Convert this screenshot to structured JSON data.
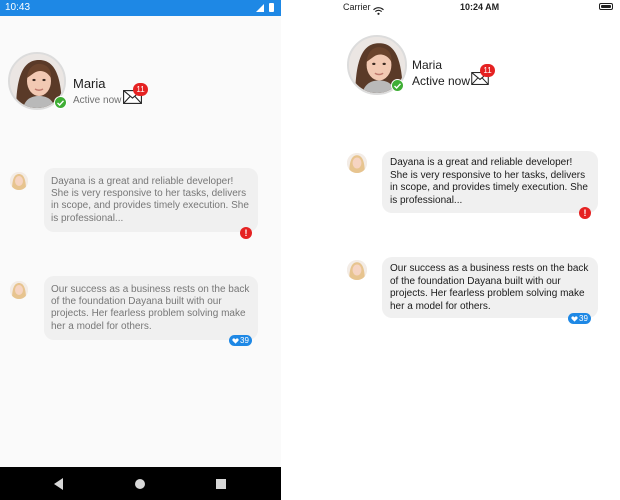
{
  "android": {
    "status_bar": {
      "time": "10:43",
      "color": "#1e88e5"
    },
    "profile": {
      "name": "Maria",
      "status": "Active now",
      "mail_count": "11",
      "online_color": "#3fae35"
    },
    "messages": [
      {
        "text": "Dayana is a great and reliable developer! She is very responsive to her tasks, delivers in scope, and provides timely execution. She is professional...",
        "indicator": "alert",
        "indicator_text": "!"
      },
      {
        "text": "Our success as a business rests on the back of the foundation Dayana built with our projects. Her fearless problem solving make her a model for others.",
        "indicator": "likes",
        "likes": "39"
      }
    ],
    "nav_bar": {
      "icons": [
        "back-icon",
        "home-icon",
        "recents-icon"
      ]
    }
  },
  "ios": {
    "status_bar": {
      "carrier": "Carrier",
      "time": "10:24 AM"
    },
    "profile": {
      "name": "Maria",
      "status": "Active now",
      "mail_count": "11"
    },
    "messages": [
      {
        "text": "Dayana is a great and reliable developer! She is very responsive to her tasks, delivers in scope, and provides timely execution. She is professional...",
        "indicator": "alert",
        "indicator_text": "!"
      },
      {
        "text": "Our success as a business rests on the back of the foundation Dayana built with our projects. Her fearless problem solving make her a model for others.",
        "indicator": "likes",
        "likes": "39"
      }
    ]
  },
  "colors": {
    "badge_red": "#e52222",
    "like_blue": "#1e88e5",
    "bubble_bg": "#f0f0f0"
  }
}
